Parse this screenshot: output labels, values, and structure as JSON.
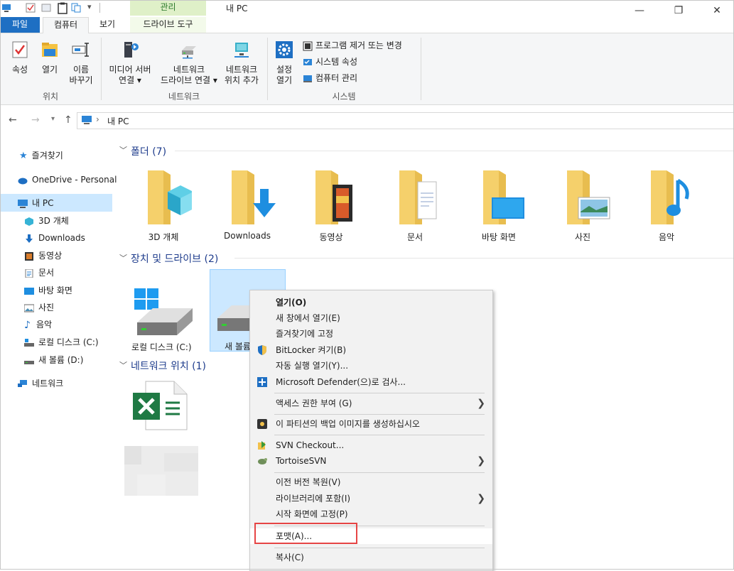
{
  "titlebar": {
    "contextual_tab": "관리",
    "window_title": "내 PC",
    "minimize": "—",
    "maximize": "❐",
    "close": "✕"
  },
  "tabs": {
    "file": "파일",
    "computer": "컴퓨터",
    "view": "보기",
    "drive_tools": "드라이브 도구"
  },
  "ribbon": {
    "location": {
      "label": "위치",
      "properties": "속성",
      "open": "열기",
      "rename_1": "이름",
      "rename_2": "바꾸기"
    },
    "network": {
      "label": "네트워크",
      "media_1": "미디어 서버",
      "media_2": "연결 ▾",
      "mapdrive_1": "네트워크",
      "mapdrive_2": "드라이브 연결 ▾",
      "addloc_1": "네트워크",
      "addloc_2": "위치 추가"
    },
    "system": {
      "label": "시스템",
      "settings_1": "설정",
      "settings_2": "열기",
      "uninstall": "프로그램 제거 또는 변경",
      "sysprops": "시스템 속성",
      "manage": "컴퓨터 관리"
    }
  },
  "address": {
    "path": "내 PC",
    "sep": "›"
  },
  "sidebar": {
    "quick": "즐겨찾기",
    "onedrive": "OneDrive - Personal",
    "thispc": "내 PC",
    "items": [
      "3D 개체",
      "Downloads",
      "동영상",
      "문서",
      "바탕 화면",
      "사진",
      "음악",
      "로컬 디스크 (C:)",
      "새 볼륨 (D:)"
    ],
    "network": "네트워크"
  },
  "content": {
    "folders_header": "폴더 (7)",
    "folders": [
      "3D 개체",
      "Downloads",
      "동영상",
      "문서",
      "바탕 화면",
      "사진",
      "음악"
    ],
    "drives_header": "장치 및 드라이브 (2)",
    "drive_c": "로컬 디스크 (C:)",
    "drive_d": "새 볼륨",
    "network_header": "네트워크 위치 (1)"
  },
  "menu": {
    "open": "열기(O)",
    "open_new": "새 창에서 열기(E)",
    "pin_quick": "즐겨찾기에 고정",
    "bitlocker": "BitLocker 켜기(B)",
    "autoplay": "자동 실행 열기(Y)...",
    "defender": "Microsoft Defender(으)로 검사...",
    "access": "액세스 권한 부여 (G)",
    "backup": "이 파티션의 백업 이미지를 생성하십시오",
    "svn_checkout": "SVN Checkout...",
    "tortoise": "TortoiseSVN",
    "restore": "이전 버전 복원(V)",
    "library": "라이브러리에 포함(I)",
    "pin_start": "시작 화면에 고정(P)",
    "format": "포맷(A)...",
    "copy": "복사(C)",
    "arrow": "❯"
  },
  "colors": {
    "accent": "#1e6fc3",
    "selection": "#cce8ff",
    "highlight_box": "#e64545",
    "folder": "#f5d06b"
  }
}
